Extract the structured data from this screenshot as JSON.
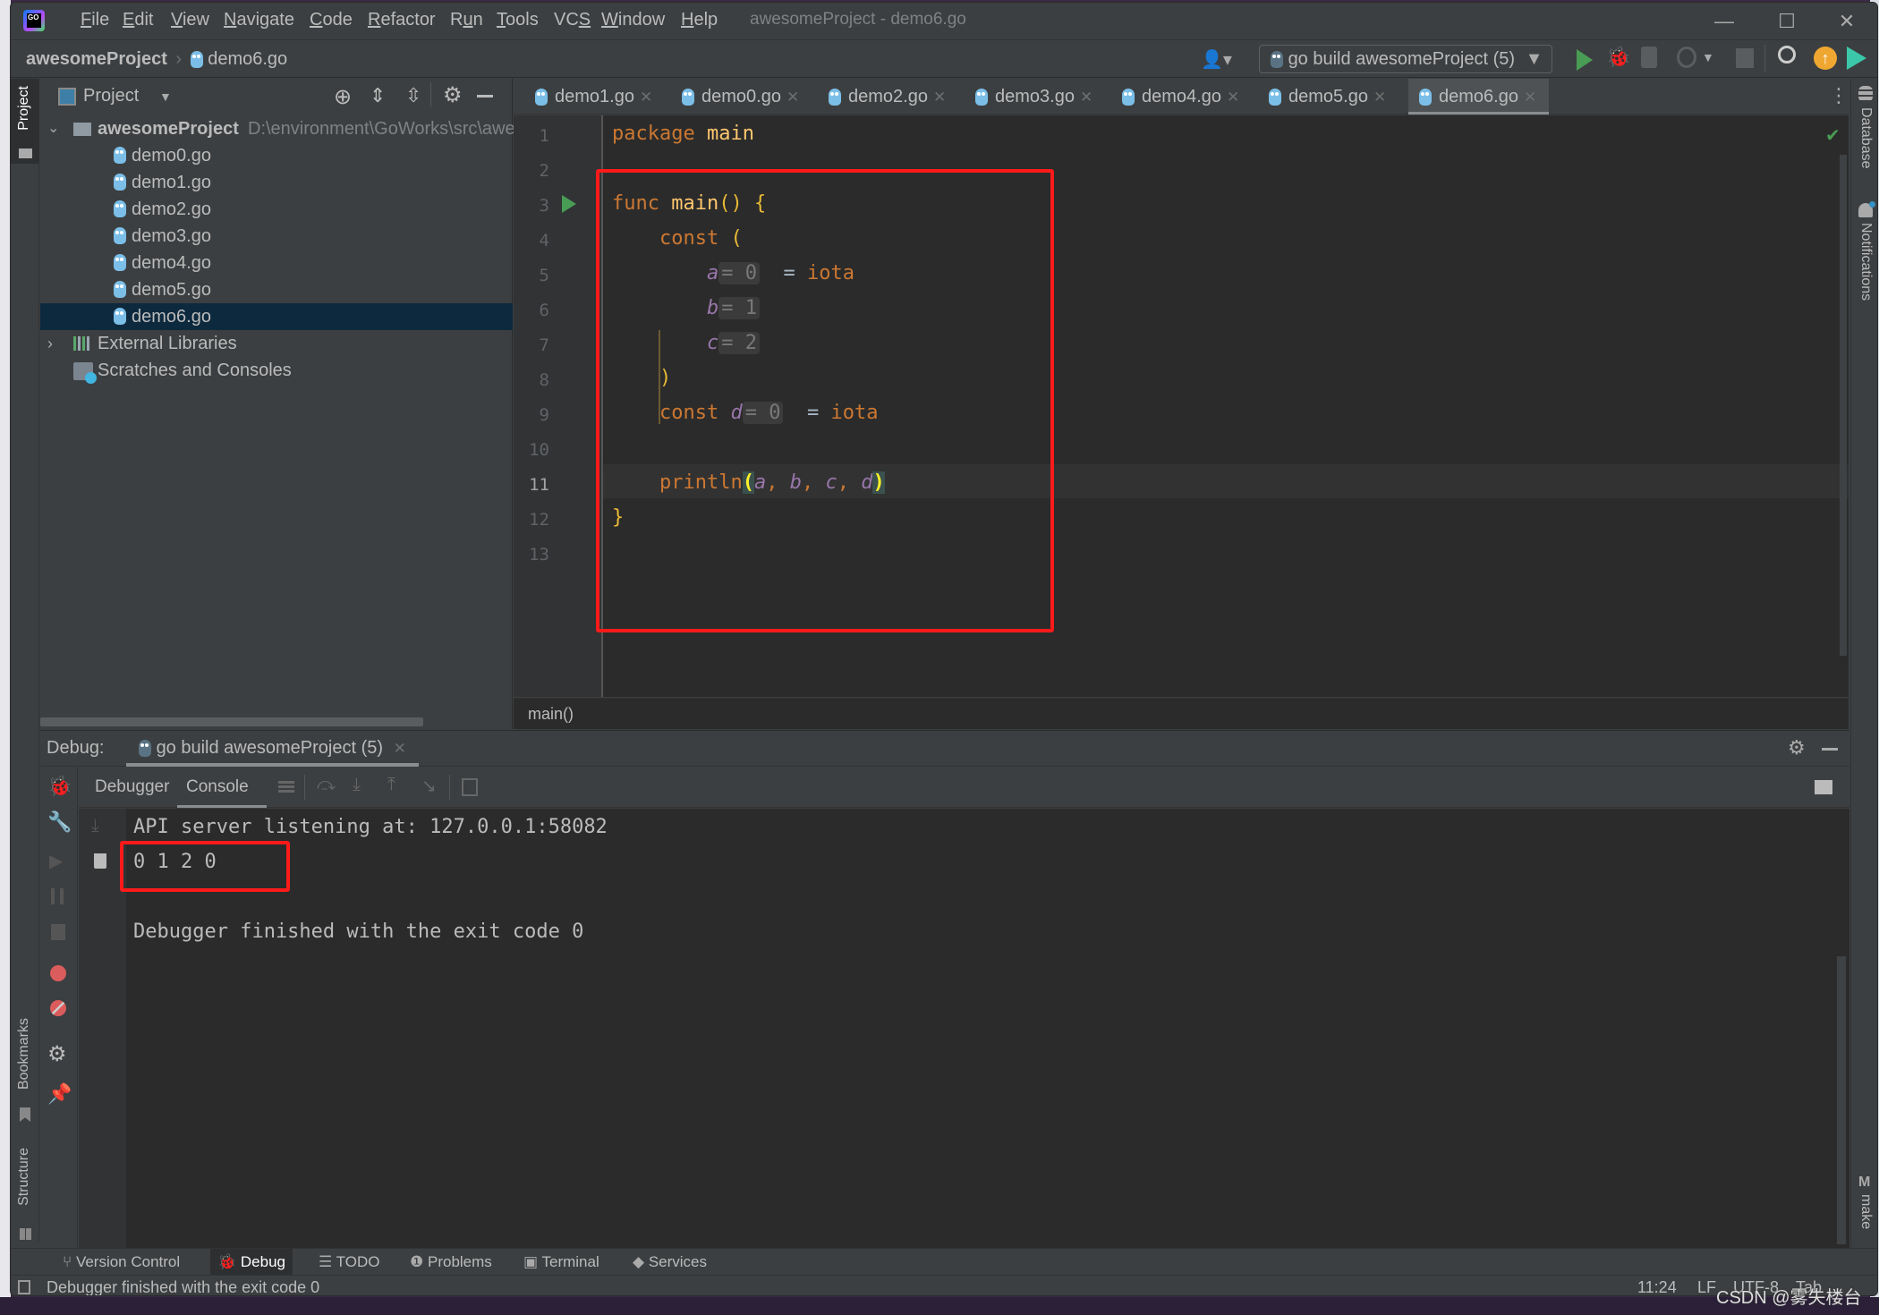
{
  "menu": [
    "File",
    "Edit",
    "View",
    "Navigate",
    "Code",
    "Refactor",
    "Run",
    "Tools",
    "VCS",
    "Window",
    "Help"
  ],
  "menu_mnemonics": [
    "F",
    "E",
    "V",
    "N",
    "C",
    "R",
    "u",
    "T",
    "S",
    "W",
    "H"
  ],
  "window_title": "awesomeProject - demo6.go",
  "window_controls": {
    "minimize": "—",
    "maximize": "☐",
    "close": "✕"
  },
  "navbar": {
    "project": "awesomeProject",
    "file": "demo6.go",
    "run_config": "go build awesomeProject (5)"
  },
  "left_strip": {
    "project": "Project",
    "bookmarks": "Bookmarks",
    "structure": "Structure"
  },
  "right_strip": {
    "database": "Database",
    "notifications": "Notifications",
    "make": "make"
  },
  "project_panel": {
    "title": "Project",
    "root": {
      "name": "awesomeProject",
      "path": "D:\\environment\\GoWorks\\src\\awes"
    },
    "files": [
      "demo0.go",
      "demo1.go",
      "demo2.go",
      "demo3.go",
      "demo4.go",
      "demo5.go",
      "demo6.go"
    ],
    "selected": "demo6.go",
    "external_libraries": "External Libraries",
    "scratches": "Scratches and Consoles"
  },
  "tabs": [
    {
      "label": "demo1.go",
      "active": false
    },
    {
      "label": "demo0.go",
      "active": false
    },
    {
      "label": "demo2.go",
      "active": false
    },
    {
      "label": "demo3.go",
      "active": false
    },
    {
      "label": "demo4.go",
      "active": false
    },
    {
      "label": "demo5.go",
      "active": false
    },
    {
      "label": "demo6.go",
      "active": true
    }
  ],
  "editor": {
    "line_numbers": [
      "1",
      "2",
      "3",
      "4",
      "5",
      "6",
      "7",
      "8",
      "9",
      "10",
      "11",
      "12",
      "13"
    ],
    "current_line": "11",
    "code": {
      "l1_kw": "package",
      "l1_name": "main",
      "l3_kw": "func",
      "l3_name": "main",
      "l3_rest": "()",
      "l3_brace": "{",
      "l4_kw": "const",
      "l4_paren": "(",
      "l5_id": "a",
      "l5_hint": "= 0",
      "l5_rest": "= ",
      "l5_iota": "iota",
      "l6_id": "b",
      "l6_hint": "= 1",
      "l7_id": "c",
      "l7_hint": "= 2",
      "l8_paren": ")",
      "l9_kw": "const",
      "l9_id": "d",
      "l9_hint": "= 0",
      "l9_rest": "= ",
      "l9_iota": "iota",
      "l11_fn": "println",
      "l11_open": "(",
      "l11_a": "a",
      "l11_b": "b",
      "l11_c": "c",
      "l11_d": "d",
      "l11_sep": ", ",
      "l11_close": ")",
      "l12_brace": "}"
    },
    "breadcrumb": "main()"
  },
  "debug": {
    "label": "Debug:",
    "session": "go build awesomeProject (5)",
    "tabs": [
      "Debugger",
      "Console"
    ],
    "active_tab": "Console",
    "output": [
      "API server listening at: 127.0.0.1:58082",
      "0 1 2 0",
      "",
      "Debugger finished with the exit code 0"
    ]
  },
  "tool_windows": [
    "Version Control",
    "Debug",
    "TODO",
    "Problems",
    "Terminal",
    "Services"
  ],
  "active_tool_window": "Debug",
  "status": {
    "message": "Debugger finished with the exit code 0",
    "position": "11:24",
    "line_sep": "LF",
    "encoding": "UTF-8",
    "indent": "Tab"
  },
  "watermark": "CSDN @雾失楼台",
  "colors": {
    "accent_run": "#499c54",
    "highlight_box": "#ff1a1a",
    "selection": "#0d293e"
  }
}
